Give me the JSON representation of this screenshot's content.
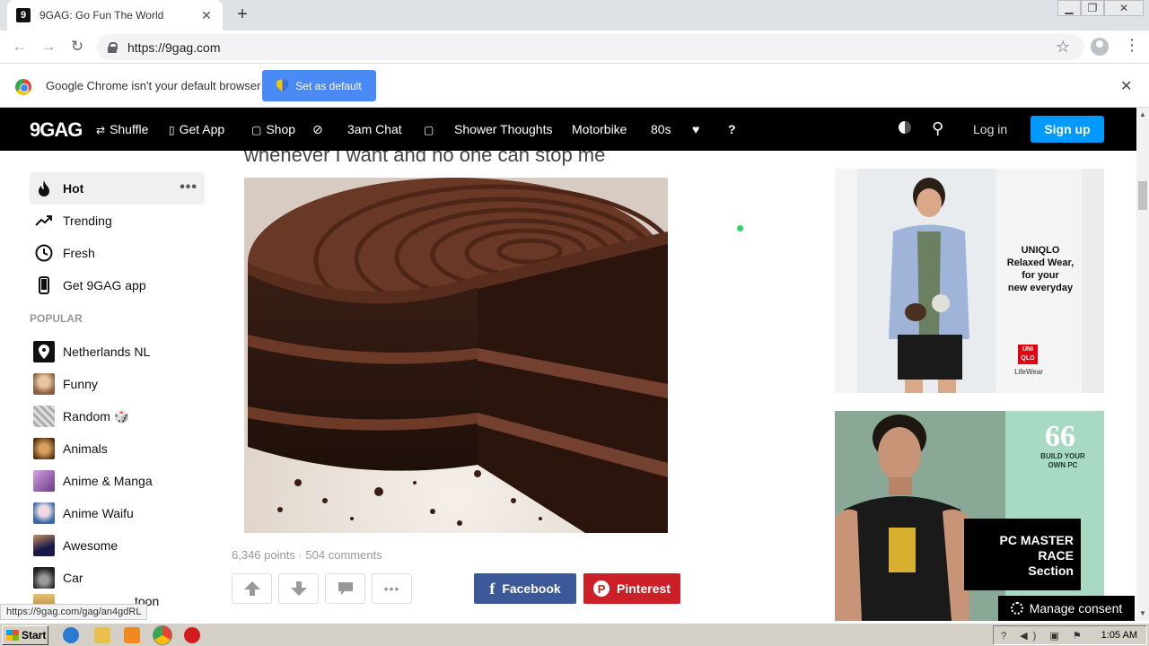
{
  "browser": {
    "tab_title": "9GAG: Go Fun The World",
    "favicon_letter": "9",
    "url": "https://9gag.com",
    "infobar_text": "Google Chrome isn't your default browser",
    "set_default_label": "Set as default"
  },
  "header": {
    "logo": "9GAG",
    "nav": [
      {
        "label": "Shuffle",
        "icon": "shuffle-icon"
      },
      {
        "label": "Get App",
        "icon": "phone-icon"
      },
      {
        "label": "Shop",
        "icon": "shop-icon"
      },
      {
        "label": "3am Chat",
        "icon": "chat-icon"
      },
      {
        "label": "Shower Thoughts"
      },
      {
        "label": "Motorbike"
      },
      {
        "label": "80s"
      },
      {
        "label": "?"
      }
    ],
    "login_label": "Log in",
    "signup_label": "Sign up"
  },
  "sidebar": {
    "main_items": [
      {
        "label": "Hot",
        "icon": "fire-icon"
      },
      {
        "label": "Trending",
        "icon": "trending-icon"
      },
      {
        "label": "Fresh",
        "icon": "clock-icon"
      },
      {
        "label": "Get 9GAG app",
        "icon": "phone-icon"
      }
    ],
    "section_title": "POPULAR",
    "popular_items": [
      {
        "label": "Netherlands NL",
        "color": "#111111"
      },
      {
        "label": "Funny",
        "color": "#b8906a"
      },
      {
        "label": "Random 🎲",
        "color": "#c8c8c8"
      },
      {
        "label": "Animals",
        "color": "#8a5a2c"
      },
      {
        "label": "Anime & Manga",
        "color": "#7a4a8c"
      },
      {
        "label": "Anime Waifu",
        "color": "#4a7ab8"
      },
      {
        "label": "Awesome",
        "color": "#2a2a5a"
      },
      {
        "label": "Car",
        "color": "#333333"
      },
      {
        "label": "toon",
        "color": "#caa060"
      }
    ]
  },
  "post": {
    "title_fragment": "whenever I want and no one can stop me",
    "points": "6,346 points",
    "separator": " · ",
    "comments": "504 comments",
    "facebook_label": "Facebook",
    "pinterest_label": "Pinterest"
  },
  "ads": {
    "uniqlo": {
      "lines": [
        "UNIQLO",
        "Relaxed Wear,",
        "for your",
        "new everyday"
      ],
      "brand_top": "UNI",
      "brand_bottom": "QLO",
      "sub": "LifeWear"
    },
    "pcmr": {
      "quote": "66",
      "build": "BUILD YOUR",
      "own": "OWN PC",
      "line1": "PC MASTER RACE",
      "line2": "Section"
    }
  },
  "status_bar_url": "https://9gag.com/gag/an4gdRL",
  "consent_label": "Manage consent",
  "taskbar": {
    "start_label": "Start",
    "clock": "1:05 AM"
  },
  "colors": {
    "signup_blue": "#0099ff",
    "facebook": "#3b5998",
    "pinterest": "#cb2027"
  }
}
